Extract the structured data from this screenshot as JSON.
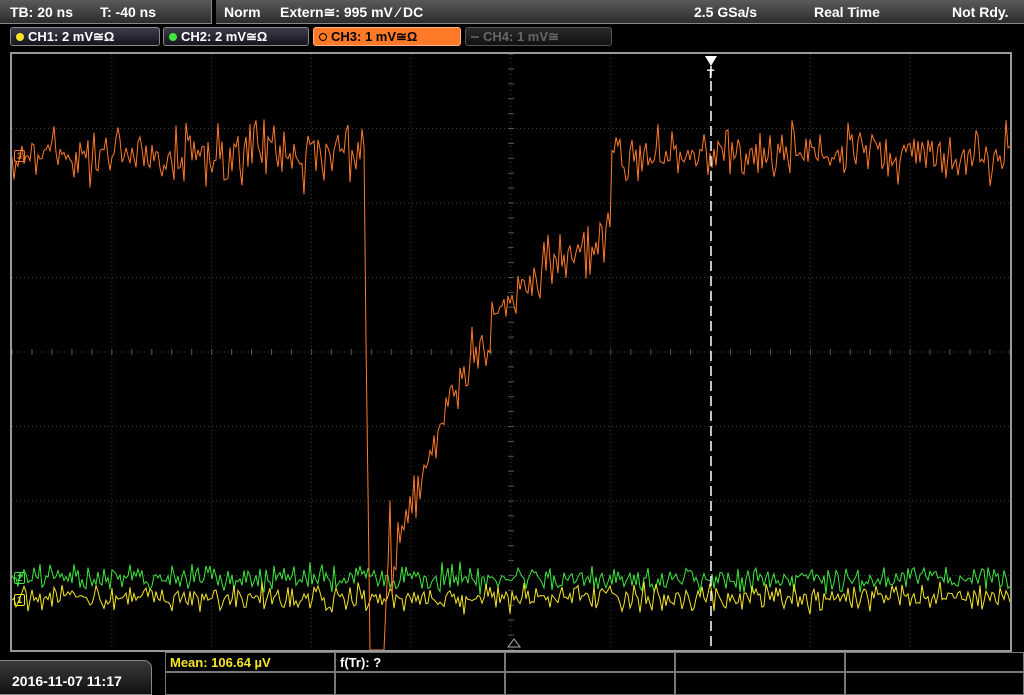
{
  "status": {
    "timebase": "TB: 20 ns",
    "trigger_time": "T: -40 ns",
    "trigger_mode": "Norm",
    "trigger_source": "Extern≅: 995 mV ⁄ DC",
    "sample_rate": "2.5 GSa/s",
    "acq_mode": "Real Time",
    "run_state": "Not Rdy."
  },
  "channels": [
    {
      "label": "CH1: 2 mV≅Ω",
      "color": "#f5e625"
    },
    {
      "label": "CH2: 2 mV≅Ω",
      "color": "#3ee83e"
    },
    {
      "label": "CH3: 1 mV≅Ω",
      "color": "#ff7a28"
    },
    {
      "label": "CH4: 1 mV≅",
      "color": "#555555"
    }
  ],
  "trigger_marker": "T",
  "markers": {
    "ch3": "3",
    "ch2": "2",
    "ch1": "1"
  },
  "footer": {
    "datetime": "2016-11-07 11:17",
    "mean_label": "Mean: 106.64 µV",
    "ftr_label": "f(Tr): ?"
  }
}
